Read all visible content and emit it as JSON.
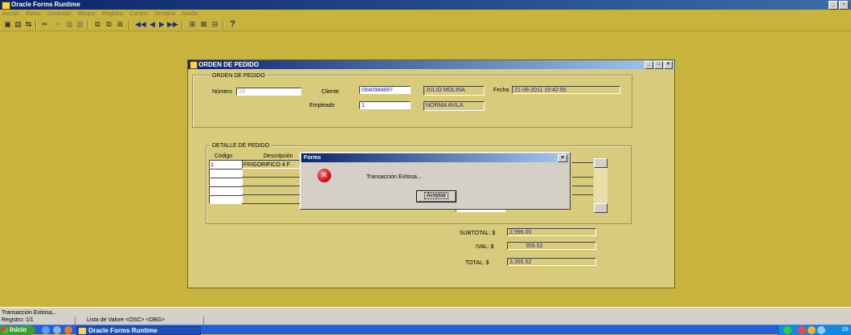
{
  "app": {
    "title": "Oracle Forms Runtime"
  },
  "menu": [
    "Acción",
    "Editar",
    "Consultar",
    "Bloque",
    "Registro",
    "Campo",
    "Ventana",
    "Ayuda"
  ],
  "toolbar": {
    "icons": [
      "save-icon",
      "print-icon",
      "exit-icon",
      "cut-icon",
      "copy-icon",
      "paste-icon",
      "enter-query-icon",
      "execute-query-icon",
      "cancel-query-icon",
      "first-record-icon",
      "previous-record-icon",
      "next-record-icon",
      "last-record-icon",
      "insert-record-icon",
      "delete-record-icon",
      "lock-record-icon",
      "help-icon"
    ],
    "help_label": "?"
  },
  "form": {
    "window_title": "ORDEN DE PEDIDO",
    "header_group_title": "ORDEN DE PEDIDO",
    "numero_label": "Número",
    "numero_value": "19",
    "cliente_label": "Cliente",
    "cliente_id": "0940984897",
    "cliente_name": "JULIO MOLINA",
    "fecha_label": "Fecha",
    "fecha_value": "21-08-2011 19:42:55",
    "empleado_label": "Empleado",
    "empleado_id": "1",
    "empleado_name": "NORMA AVILA",
    "detail_group_title": "DETALLE DE PEDIDO",
    "detail_columns": [
      "Código",
      "Descripción"
    ],
    "detail_rows": [
      {
        "codigo": "1",
        "descripcion": "FRIGORIFICO 4 F"
      },
      {
        "codigo": "",
        "descripcion": ""
      },
      {
        "codigo": "",
        "descripcion": ""
      },
      {
        "codigo": "",
        "descripcion": ""
      },
      {
        "codigo": "",
        "descripcion": ""
      }
    ],
    "subtotal_label": "SUBTOTAL: $",
    "subtotal_value": "2,996.00",
    "iva_label": "IVAL: $",
    "iva_value": "359.52",
    "total_label": "TOTAL: $",
    "total_value": "3,355.52"
  },
  "dialog": {
    "title": "Forms",
    "message": "Transacción Exitosa...",
    "button_label": "Aceptar"
  },
  "status": {
    "message": "Transacción Exitosa...",
    "record": "Registro: 1/1",
    "lov": "Lista de Valore <OSC> <DBG>"
  },
  "taskbar": {
    "start_label": "Inicio",
    "task_label": "Oracle Forms Runtime",
    "clock": "19:"
  }
}
